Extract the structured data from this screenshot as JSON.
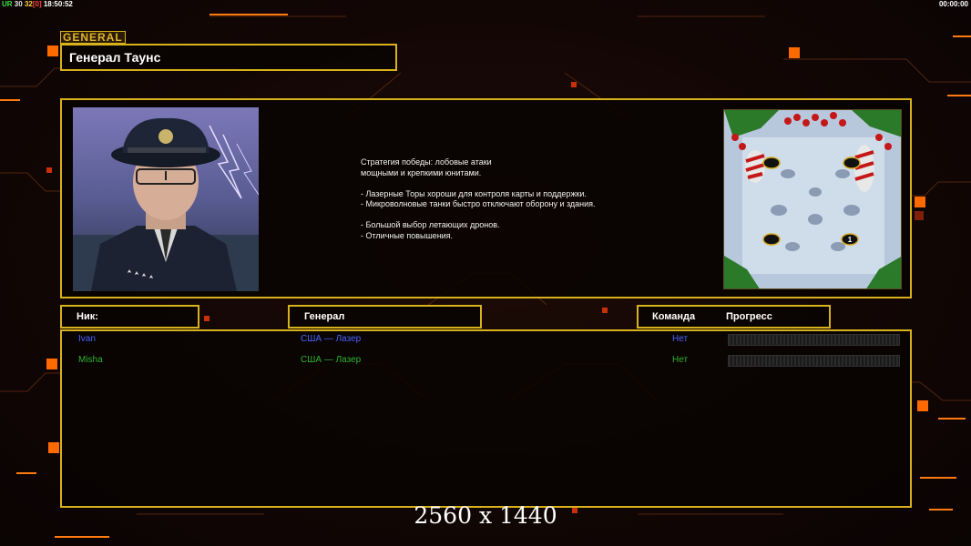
{
  "hud": {
    "fps_prefix": "UR",
    "fps_a": "30",
    "fps_b": "32",
    "fps_c": "[0]",
    "clock": "18:50:52",
    "timer": "00:00:00"
  },
  "general": {
    "tag": "GENERAL",
    "name": "Генерал Таунс",
    "description_lines": [
      "Стратегия победы: лобовые атаки",
      "мощными и крепкими юнитами.",
      "",
      "- Лазерные Торы хороши для контроля карты и поддержки.",
      "- Микроволновые танки быстро отключают оборону и здания.",
      "",
      "- Большой выбор летающих дронов.",
      "- Отличные повышения."
    ]
  },
  "map": {
    "start_marker": "1"
  },
  "table": {
    "headers": {
      "nick": "Ник:",
      "general": "Генерал",
      "team": "Команда",
      "progress": "Прогресс"
    },
    "rows": [
      {
        "nick": "Ivan",
        "general": "США — Лазер",
        "team": "Нет",
        "color": "#4a63ff",
        "progress": 0
      },
      {
        "nick": "Misha",
        "general": "США — Лазер",
        "team": "Нет",
        "color": "#2fb52f",
        "progress": 0
      }
    ]
  },
  "footer": {
    "resolution": "2560 x 1440"
  },
  "colors": {
    "frame": "#d8b21c",
    "accent": "#ff6a00"
  }
}
